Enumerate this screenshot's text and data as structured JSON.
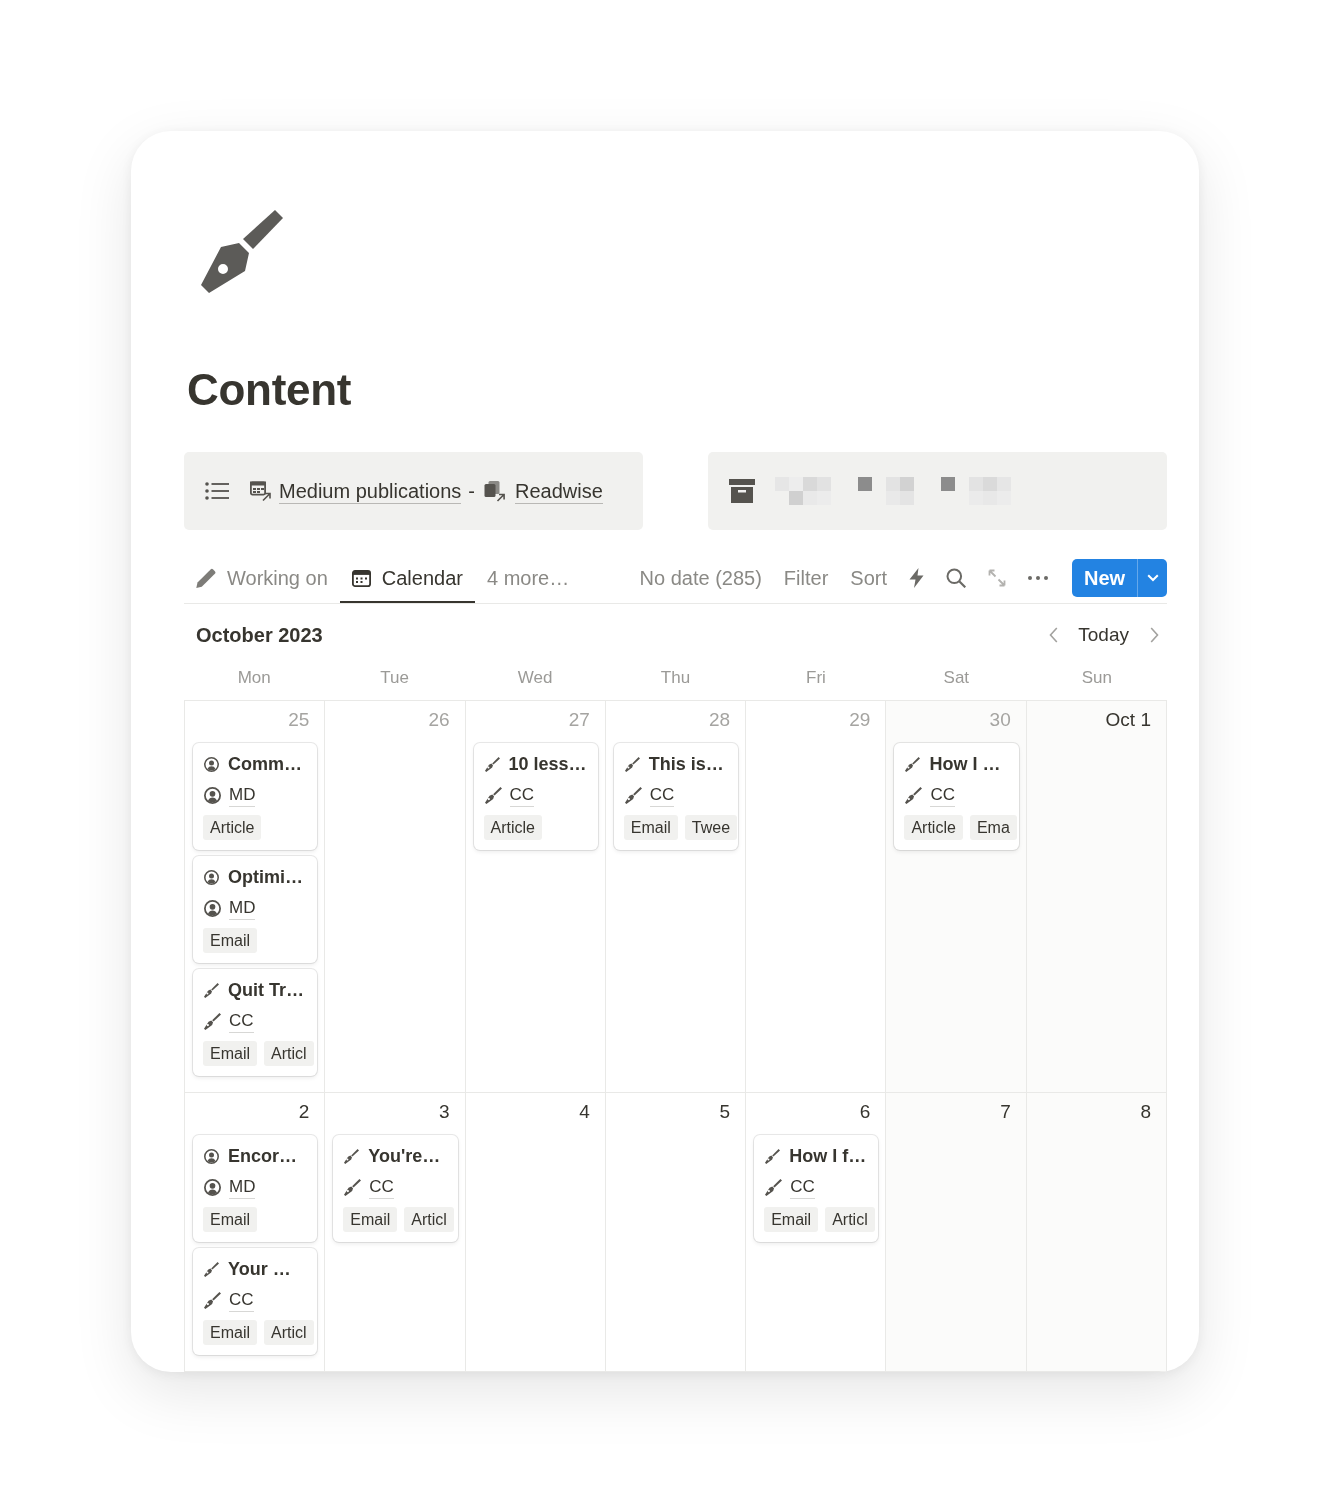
{
  "page": {
    "title": "Content"
  },
  "links": {
    "items": [
      {
        "label": "Medium publications",
        "kind": "calendar"
      },
      {
        "label": "Readwise",
        "kind": "pages"
      }
    ],
    "separator": "-"
  },
  "views": {
    "tabs": [
      {
        "label": "Working on",
        "kind": "pencil",
        "selected": false
      },
      {
        "label": "Calendar",
        "kind": "calendar",
        "selected": true
      }
    ],
    "more": "4 more…"
  },
  "toolbar": {
    "no_date": "No date (285)",
    "filter": "Filter",
    "sort": "Sort",
    "new_button": "New"
  },
  "calendar": {
    "month": "October 2023",
    "today": "Today",
    "weekdays": [
      "Mon",
      "Tue",
      "Wed",
      "Thu",
      "Fri",
      "Sat",
      "Sun"
    ],
    "weeks": [
      {
        "days": [
          {
            "label": "25",
            "in_month": false,
            "cards": [
              {
                "title": "Comm…",
                "kind": "person",
                "owner": "MD",
                "tags": [
                  "Article"
                ]
              },
              {
                "title": "Optimi…",
                "kind": "person",
                "owner": "MD",
                "tags": [
                  "Email"
                ]
              },
              {
                "title": "Quit Tr…",
                "kind": "pen",
                "owner": "CC",
                "tags": [
                  "Email",
                  "Articl"
                ]
              }
            ]
          },
          {
            "label": "26",
            "in_month": false
          },
          {
            "label": "27",
            "in_month": false,
            "cards": [
              {
                "title": "10 less…",
                "kind": "pen",
                "owner": "CC",
                "tags": [
                  "Article"
                ]
              }
            ]
          },
          {
            "label": "28",
            "in_month": false,
            "cards": [
              {
                "title": "This is…",
                "kind": "pen",
                "owner": "CC",
                "tags": [
                  "Email",
                  "Twee"
                ]
              }
            ]
          },
          {
            "label": "29",
            "in_month": false
          },
          {
            "label": "30",
            "in_month": false,
            "cards": [
              {
                "title": "How I …",
                "kind": "pen",
                "owner": "CC",
                "tags": [
                  "Article",
                  "Ema"
                ]
              }
            ]
          },
          {
            "label": "Oct 1",
            "in_month": true
          }
        ]
      },
      {
        "days": [
          {
            "label": "2",
            "in_month": true,
            "cards": [
              {
                "title": "Encor…",
                "kind": "person",
                "owner": "MD",
                "tags": [
                  "Email"
                ]
              },
              {
                "title": "Your …",
                "kind": "pen",
                "owner": "CC",
                "tags": [
                  "Email",
                  "Articl"
                ]
              }
            ]
          },
          {
            "label": "3",
            "in_month": true,
            "cards": [
              {
                "title": "You're…",
                "kind": "pen",
                "owner": "CC",
                "tags": [
                  "Email",
                  "Articl"
                ]
              }
            ]
          },
          {
            "label": "4",
            "in_month": true
          },
          {
            "label": "5",
            "in_month": true
          },
          {
            "label": "6",
            "in_month": true,
            "cards": [
              {
                "title": "How I f…",
                "kind": "pen",
                "owner": "CC",
                "tags": [
                  "Email",
                  "Articl"
                ]
              }
            ]
          },
          {
            "label": "7",
            "in_month": true
          },
          {
            "label": "8",
            "in_month": true
          }
        ]
      }
    ]
  }
}
